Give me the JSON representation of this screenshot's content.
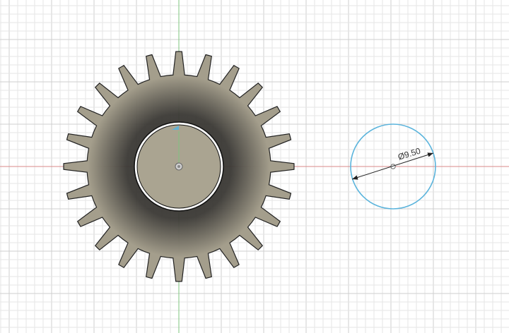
{
  "viewport": {
    "background": "#ffffff",
    "grid_minor_color": "#e6e6e6",
    "grid_major_color": "#cfcfcf",
    "x_axis_color": "#d98a8a",
    "y_axis_color": "#7fc47f"
  },
  "gear": {
    "teeth": 24,
    "body_color": "#a49e8c",
    "shadow_color": "#3a3834",
    "outline_color": "#222222"
  },
  "bore": {
    "fill": "#aaa491",
    "outline_color": "#111111"
  },
  "sketch_circle": {
    "stroke": "#5bb4dc",
    "dimension_label": "Ø9.50"
  }
}
